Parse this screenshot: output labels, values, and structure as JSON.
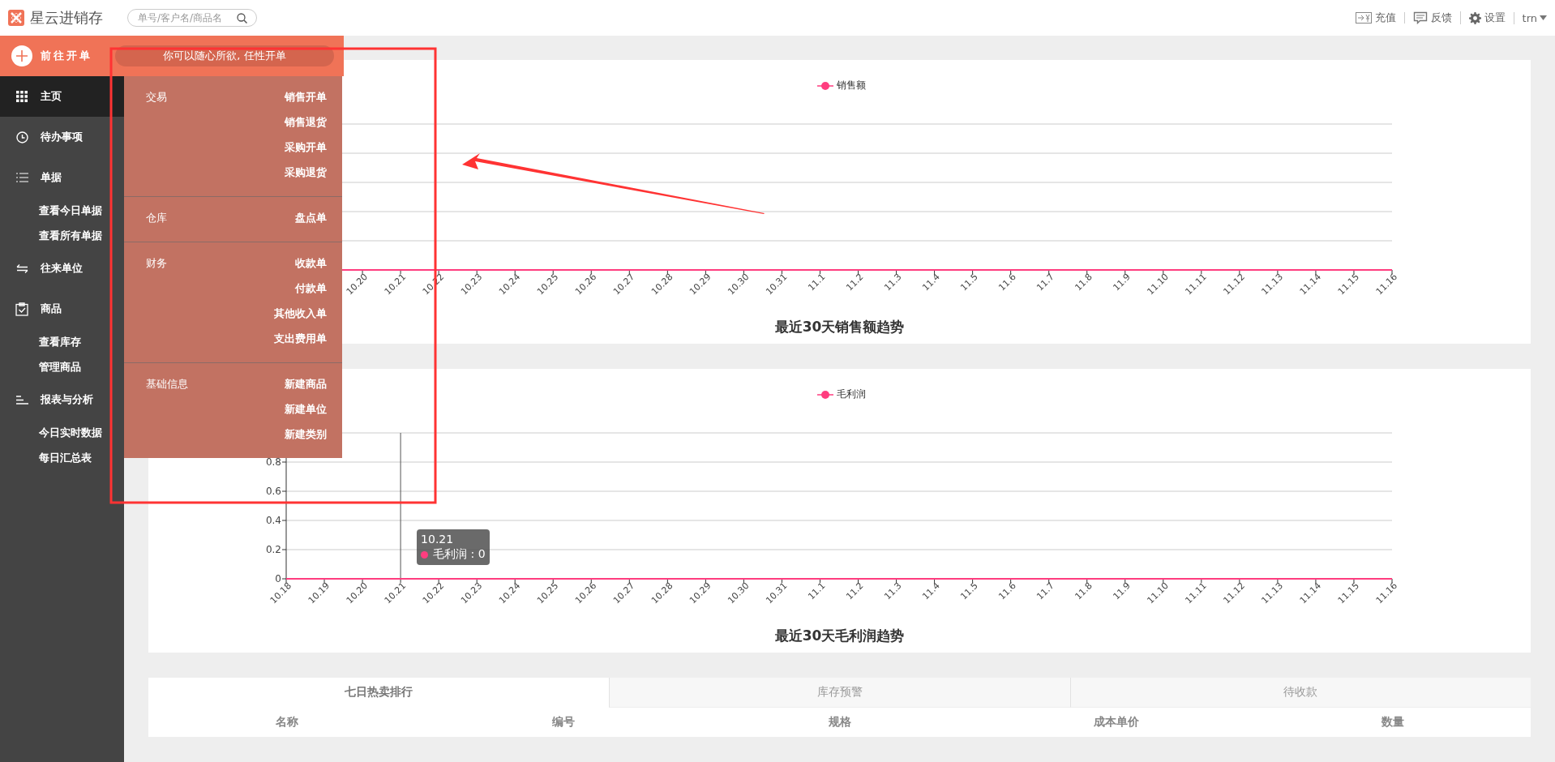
{
  "header": {
    "app_name": "星云进销存",
    "search": {
      "placeholder": "单号/客户名/商品名"
    },
    "actions": [
      {
        "label": "充值",
        "kind": "recharge"
      },
      {
        "label": "反馈",
        "kind": "feedback"
      },
      {
        "label": "设置",
        "kind": "settings"
      }
    ],
    "user": "trn"
  },
  "quick_order": {
    "button": "前往开单",
    "hint": "你可以随心所欲, 任性开单",
    "groups": [
      {
        "name": "交易",
        "items": [
          "销售开单",
          "销售退货",
          "采购开单",
          "采购退货"
        ]
      },
      {
        "name": "仓库",
        "items": [
          "盘点单"
        ]
      },
      {
        "name": "财务",
        "items": [
          "收款单",
          "付款单",
          "其他收入单",
          "支出费用单"
        ]
      },
      {
        "name": "基础信息",
        "items": [
          "新建商品",
          "新建单位",
          "新建类别"
        ]
      }
    ]
  },
  "sidebar": {
    "items": [
      {
        "label": "主页",
        "kind": "home",
        "selected": true
      },
      {
        "label": "待办事项",
        "kind": "todo",
        "selected": false
      },
      {
        "label": "单据",
        "kind": "documents",
        "selected": false,
        "children": [
          {
            "label": "查看今日单据",
            "selected": false
          },
          {
            "label": "查看所有单据",
            "selected": false
          }
        ]
      },
      {
        "label": "往来单位",
        "kind": "partners",
        "selected": false
      },
      {
        "label": "商品",
        "kind": "goods",
        "selected": false,
        "children": [
          {
            "label": "查看库存",
            "selected": false
          },
          {
            "label": "管理商品",
            "selected": false
          }
        ]
      },
      {
        "label": "报表与分析",
        "kind": "reports",
        "selected": false,
        "children": [
          {
            "label": "今日实时数据",
            "selected": false
          },
          {
            "label": "每日汇总表",
            "selected": false
          }
        ]
      }
    ]
  },
  "charts": [
    {
      "legend": "销售额",
      "title": "最近30天销售额趋势",
      "x_labels": [
        "10.20",
        "10.21",
        "10.22",
        "10.23",
        "10.24",
        "10.25",
        "10.26",
        "10.27",
        "10.28",
        "10.29",
        "10.30",
        "10.31",
        "11.1",
        "11.2",
        "11.3",
        "11.4",
        "11.5",
        "11.6",
        "11.7",
        "11.8",
        "11.9",
        "11.10",
        "11.11",
        "11.12",
        "11.13",
        "11.14",
        "11.15",
        "11.16"
      ]
    },
    {
      "chart_data": {
        "type": "line",
        "title": "最近30天毛利润趋势",
        "categories": [
          "10.18",
          "10.19",
          "10.20",
          "10.21",
          "10.22",
          "10.23",
          "10.24",
          "10.25",
          "10.26",
          "10.27",
          "10.28",
          "10.29",
          "10.30",
          "10.31",
          "11.1",
          "11.2",
          "11.3",
          "11.4",
          "11.5",
          "11.6",
          "11.7",
          "11.8",
          "11.9",
          "11.10",
          "11.11",
          "11.12",
          "11.13",
          "11.14",
          "11.15",
          "11.16"
        ],
        "ylim": [
          0,
          1
        ],
        "yticks": [
          0,
          0.2,
          0.4,
          0.6,
          0.8
        ],
        "grid": true,
        "ref_lines": [
          {
            "axis": "x",
            "value": "10.21",
            "color": "#555555"
          }
        ],
        "series": [
          {
            "name": "毛利润",
            "color": "#ff3d7f",
            "values": [
              0,
              0,
              0,
              0,
              0,
              0,
              0,
              0,
              0,
              0,
              0,
              0,
              0,
              0,
              0,
              0,
              0,
              0,
              0,
              0,
              0,
              0,
              0,
              0,
              0,
              0,
              0,
              0,
              0,
              0
            ]
          }
        ]
      },
      "tooltip": {
        "title": "10.21",
        "text": "毛利润 : 0"
      }
    }
  ],
  "bottom_panel": {
    "tabs": [
      {
        "label": "七日热卖排行",
        "selected": true
      },
      {
        "label": "库存预警",
        "selected": false
      },
      {
        "label": "待收款",
        "selected": false
      }
    ],
    "columns": [
      "名称",
      "编号",
      "规格",
      "成本单价",
      "数量"
    ]
  }
}
